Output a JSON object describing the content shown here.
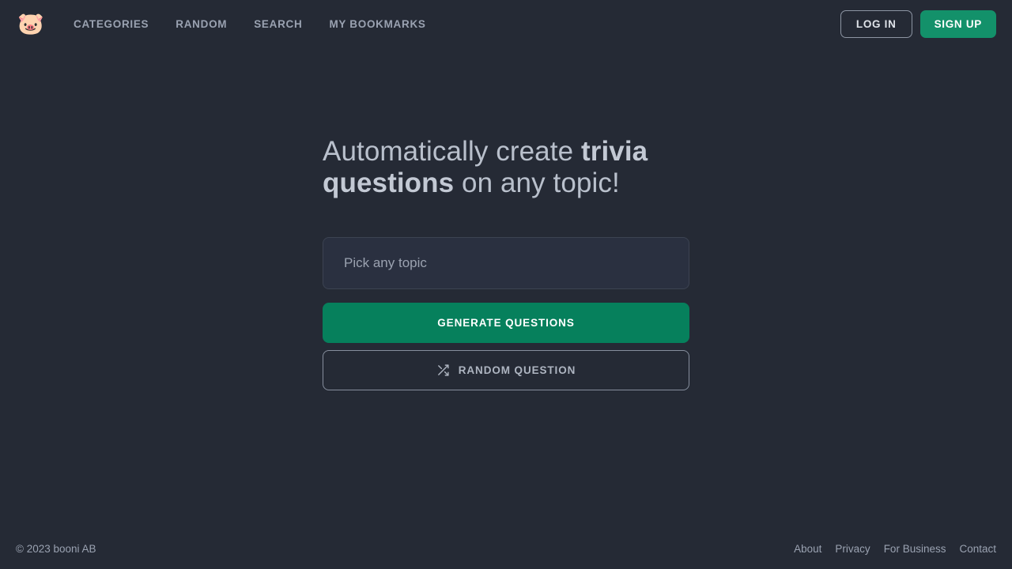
{
  "header": {
    "logo": {
      "icon": "pig-face-icon",
      "glyph": "🐷"
    },
    "nav": [
      {
        "label": "CATEGORIES",
        "name": "categories"
      },
      {
        "label": "RANDOM",
        "name": "random"
      },
      {
        "label": "SEARCH",
        "name": "search"
      },
      {
        "label": "MY BOOKMARKS",
        "name": "my-bookmarks"
      }
    ],
    "auth": {
      "login_label": "LOG IN",
      "signup_label": "SIGN UP"
    }
  },
  "hero": {
    "headline_part1": "Automatically create ",
    "headline_bold1": "trivia questions",
    "headline_part2": " on any topic!",
    "input_placeholder": "Pick any topic",
    "input_value": "",
    "generate_label": "GENERATE QUESTIONS",
    "random_label": "RANDOM QUESTION",
    "random_icon": "shuffle-icon"
  },
  "footer": {
    "copyright": "© 2023 booni AB",
    "links": [
      {
        "label": "About",
        "name": "about"
      },
      {
        "label": "Privacy",
        "name": "privacy"
      },
      {
        "label": "For Business",
        "name": "for-business"
      },
      {
        "label": "Contact",
        "name": "contact"
      }
    ]
  },
  "colors": {
    "background": "#252a35",
    "input_fill": "#2a3040",
    "accent_green": "#06805c",
    "signup_green": "#13916a",
    "text_primary": "#b9c0cc",
    "text_muted": "#9aa2b1"
  }
}
